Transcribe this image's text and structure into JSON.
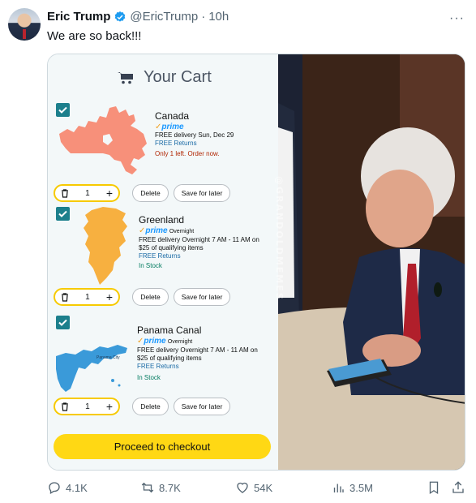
{
  "post": {
    "author_name": "Eric Trump",
    "handle": "@EricTrump",
    "separator": "·",
    "time": "10h",
    "text": "We are so back!!!",
    "more_label": "···"
  },
  "cart": {
    "title": "Your Cart",
    "checkout_label": "Proceed to checkout",
    "watermark": "@GRANDOLDMEMES",
    "items": [
      {
        "name": "Canada",
        "prime": "prime",
        "prime_suffix": "",
        "delivery": "FREE delivery Sun, Dec 29",
        "qualifying": "",
        "returns": "FREE Returns",
        "stock": "Only 1 left. Order now.",
        "qty": "1",
        "delete_label": "Delete",
        "save_label": "Save for later"
      },
      {
        "name": "Greenland",
        "prime": "prime",
        "prime_suffix": "Overnight",
        "delivery": "FREE delivery Overnight 7 AM - 11 AM on",
        "qualifying": "$25 of qualifying items",
        "returns": "FREE Returns",
        "stock": "In Stock",
        "qty": "1",
        "delete_label": "Delete",
        "save_label": "Save for later"
      },
      {
        "name": "Panama Canal",
        "prime": "prime",
        "prime_suffix": "Overnight",
        "delivery": "FREE delivery Overnight 7 AM - 11 AM on",
        "qualifying": "$25 of qualifying items",
        "returns": "FREE Returns",
        "stock": "In Stock",
        "map_label": "Panama City",
        "qty": "1",
        "delete_label": "Delete",
        "save_label": "Save for later"
      }
    ]
  },
  "actions": {
    "replies": "4.1K",
    "reposts": "8.7K",
    "likes": "54K",
    "views": "3.5M"
  },
  "colors": {
    "verified": "#1d9bf0",
    "checkbox": "#1c7f8c",
    "checkout": "#ffd814",
    "qty_border": "#f7ca00",
    "canada": "#f7907a",
    "greenland": "#f7b040",
    "panama": "#3a9ad9"
  },
  "icons": [
    "verified-badge-icon",
    "cart-icon",
    "check-icon",
    "trash-icon",
    "plus-icon",
    "reply-icon",
    "repost-icon",
    "like-icon",
    "views-icon",
    "bookmark-icon",
    "share-icon"
  ]
}
